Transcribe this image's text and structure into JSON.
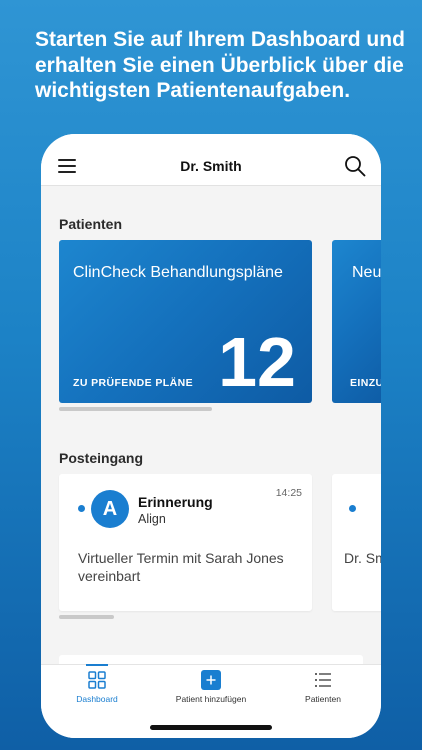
{
  "promo": {
    "headline": "Starten Sie auf Ihrem Dashboard und erhalten Sie einen Überblick über die wichtigsten Patientenaufgaben."
  },
  "header": {
    "title": "Dr. Smith",
    "menu_icon": "hamburger-menu-icon",
    "search_icon": "search-icon"
  },
  "patients": {
    "section_title": "Patienten",
    "cards": [
      {
        "title": "ClinCheck Behandlungspläne",
        "subtitle": "ZU PRÜFENDE PLÄNE",
        "count": "12"
      },
      {
        "title": "Neu",
        "subtitle": "EINZU",
        "count": ""
      }
    ]
  },
  "inbox": {
    "section_title": "Posteingang",
    "messages": [
      {
        "avatar_letter": "A",
        "sender": "Erinnerung",
        "subsender": "Align",
        "time": "14:25",
        "body": "Virtueller Termin mit Sarah Jones vereinbart",
        "unread": true
      },
      {
        "avatar_letter": "",
        "sender": "",
        "subsender": "",
        "time": "",
        "body": "Dr. Sm",
        "unread": true
      }
    ]
  },
  "bottom_nav": {
    "items": [
      {
        "label": "Dashboard",
        "icon": "dashboard-icon",
        "active": true
      },
      {
        "label": "Patient hinzufügen",
        "icon": "add-patient-icon",
        "active": false
      },
      {
        "label": "Patienten",
        "icon": "patient-list-icon",
        "active": false
      }
    ]
  },
  "colors": {
    "accent": "#1a7ed0",
    "background_top": "#2f95d4",
    "background_bottom": "#0f5fa6"
  }
}
